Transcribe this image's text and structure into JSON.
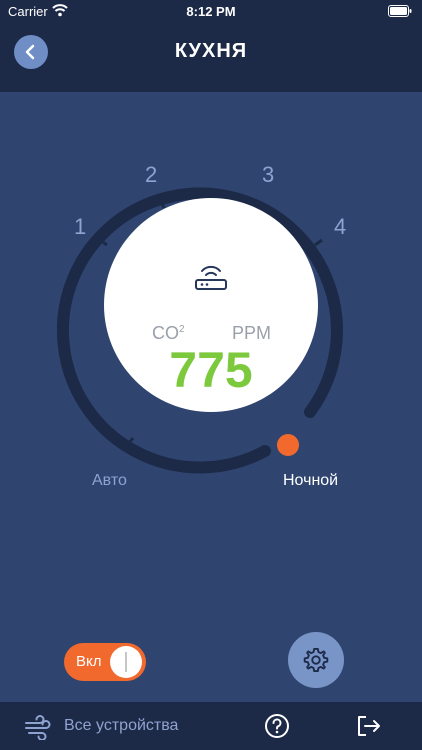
{
  "status_bar": {
    "carrier": "Carrier",
    "time": "8:12 PM"
  },
  "header": {
    "title": "КУХНЯ",
    "back_icon": "chevron-left-icon"
  },
  "dial": {
    "scale_labels": [
      "1",
      "2",
      "3",
      "4"
    ],
    "mode_auto": "Авто",
    "mode_night": "Ночной",
    "device_icon": "router-icon",
    "co2_label": "CO",
    "co2_sup": "2",
    "unit_label": "PPM",
    "co2_value": "775",
    "accent_color": "#f2692e",
    "value_color": "#7dc93e"
  },
  "controls": {
    "toggle_label": "Вкл",
    "toggle_on": true,
    "settings_icon": "gear-icon"
  },
  "tab_bar": {
    "devices_label": "Все устройства",
    "devices_icon": "fan-icon",
    "help_icon": "question-icon",
    "logout_icon": "logout-icon"
  }
}
